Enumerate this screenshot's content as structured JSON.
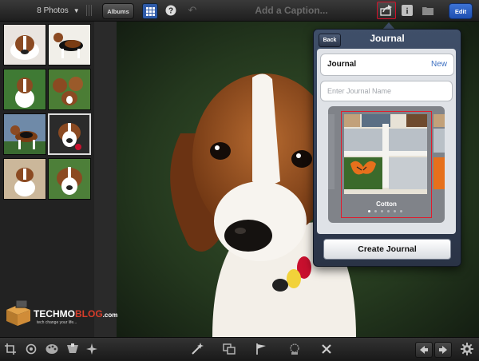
{
  "topbar": {
    "photo_count": "8 Photos",
    "albums_label": "Albums",
    "caption_placeholder": "Add a Caption...",
    "edit_label": "Edit"
  },
  "thumbnails": [
    {
      "subject": "beagle-puppy-lying"
    },
    {
      "subject": "beagle-standing-side"
    },
    {
      "subject": "beagle-sitting-grass"
    },
    {
      "subject": "three-beagle-puppies"
    },
    {
      "subject": "beagle-standing-grass"
    },
    {
      "subject": "beagle-with-tag",
      "selected": true
    },
    {
      "subject": "beagle-puppy-beige"
    },
    {
      "subject": "beagle-puppy-closeup"
    }
  ],
  "main_photo": {
    "subject": "beagle looking up"
  },
  "popover": {
    "back_label": "Back",
    "title": "Journal",
    "journal_label": "Journal",
    "new_label": "New",
    "name_placeholder": "Enter Journal Name",
    "theme_name": "Cotton",
    "page_count": 6,
    "current_page": 1,
    "create_label": "Create Journal"
  },
  "watermark": {
    "brand_main": "TECHMO",
    "brand_accent": "BLOG",
    "brand_suffix": ".com",
    "tagline": "tech change your life..."
  },
  "bottombar": {
    "left_tools": [
      "crop-icon",
      "rotate-icon",
      "palette-icon",
      "brushes-icon",
      "effects-icon"
    ],
    "center_tools": [
      "magic-wand-icon",
      "copy-icon",
      "flag-icon",
      "stamp-icon",
      "reject-icon"
    ],
    "right_tools": [
      "previous-arrow-icon",
      "next-arrow-icon",
      "gear-icon"
    ]
  },
  "colors": {
    "accent_blue": "#2e5aa8",
    "highlight_red": "#d2112a",
    "popover_frame": "#3f4f69"
  }
}
